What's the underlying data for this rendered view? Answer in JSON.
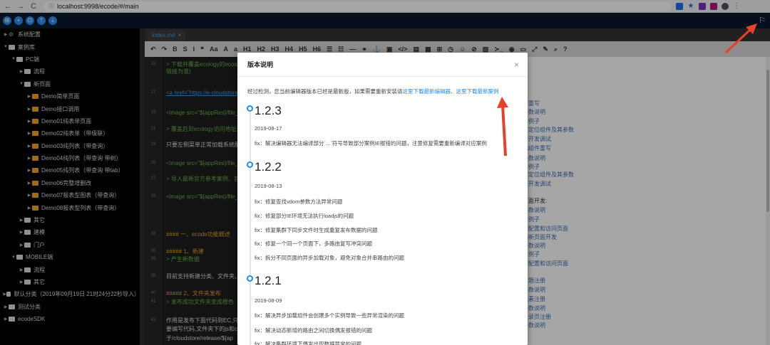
{
  "browser": {
    "url": "localhost:9998/ecode/#/main",
    "back": "←",
    "forward": "→",
    "reload": "C"
  },
  "appbar": {
    "tools": [
      "⊞",
      "+",
      "⊡",
      "⤒",
      "⤓"
    ],
    "flag": "⚐"
  },
  "sidebar": {
    "items": [
      {
        "label": "系统配置",
        "depth": 0,
        "icon": "gear"
      },
      {
        "label": "案例库",
        "depth": 0,
        "icon": "white",
        "open": true
      },
      {
        "label": "PC端",
        "depth": 1,
        "icon": "white",
        "open": true
      },
      {
        "label": "流程",
        "depth": 2,
        "icon": "white"
      },
      {
        "label": "新页面",
        "depth": 2,
        "icon": "white",
        "open": true
      },
      {
        "label": "Demo简单页面",
        "depth": 3,
        "icon": "orange"
      },
      {
        "label": "Demo接口调用",
        "depth": 3,
        "icon": "orange"
      },
      {
        "label": "Demo01纯表单页面",
        "depth": 3,
        "icon": "orange"
      },
      {
        "label": "Demo02纯表单（带级联）",
        "depth": 3,
        "icon": "orange"
      },
      {
        "label": "Demo03纯列表（带查询）",
        "depth": 3,
        "icon": "orange"
      },
      {
        "label": "Demo04纯列表（带查询 带树）",
        "depth": 3,
        "icon": "orange"
      },
      {
        "label": "Demo05纯列表（带查询 带tab）",
        "depth": 3,
        "icon": "orange"
      },
      {
        "label": "Demo06完整增删改",
        "depth": 3,
        "icon": "orange"
      },
      {
        "label": "Demo07报表型图表（带查询）",
        "depth": 3,
        "icon": "orange"
      },
      {
        "label": "Demo08报表型列表（带查询）",
        "depth": 3,
        "icon": "orange"
      },
      {
        "label": "其它",
        "depth": 2,
        "icon": "white"
      },
      {
        "label": "建模",
        "depth": 2,
        "icon": "white"
      },
      {
        "label": "门户",
        "depth": 2,
        "icon": "white"
      },
      {
        "label": "MOBILE端",
        "depth": 1,
        "icon": "white",
        "open": true
      },
      {
        "label": "流程",
        "depth": 2,
        "icon": "white"
      },
      {
        "label": "其它",
        "depth": 2,
        "icon": "white"
      },
      {
        "label": "默认分类（2019年09月19日 21时24分22秒导入）",
        "depth": 0,
        "icon": "white"
      },
      {
        "label": "测试分类",
        "depth": 0,
        "icon": "white"
      },
      {
        "label": "ecodeSDK",
        "depth": 0,
        "icon": "white"
      }
    ]
  },
  "editor": {
    "tab_label": "index.md",
    "tab_close": "×",
    "toolbar": [
      "↶",
      "↷",
      "B",
      "S",
      "I",
      "❝",
      "Aa",
      "A",
      "a",
      "H1",
      "H2",
      "H3",
      "H4",
      "H5",
      "H6",
      "☰",
      "☷",
      "—",
      "⚭",
      "⚓",
      "▣",
      "</>",
      "▤",
      "▦",
      "⊞",
      "◷",
      "☺",
      "⊘",
      "▨",
      "≻_",
      "◉",
      "▭",
      "⤢",
      "✎",
      "⌕",
      "?"
    ],
    "lines": [
      {
        "n": "15",
        "text": "> 下载并覆盖ecology的ecode",
        "cls": "c-green"
      },
      {
        "n": "",
        "text": "链接为准)",
        "cls": "c-green"
      },
      {
        "n": "17",
        "text": "<a href=\"https://e-cloudstore",
        "cls": "c-link"
      },
      {
        "n": "19",
        "text": "<image src=\"${appRes}/file_",
        "cls": "c-green"
      },
      {
        "n": "21",
        "text": "> 覆盖后到ecology访问地址进",
        "cls": "c-green"
      },
      {
        "n": "23",
        "text": "只要左侧菜单正常加载系统配",
        "cls": "c-white"
      },
      {
        "n": "25",
        "text": "<image src=\"${appRes}/file_",
        "cls": "c-green"
      },
      {
        "n": "27",
        "text": "> 导入最新官方参考案例，首",
        "cls": "c-green"
      },
      {
        "n": "29",
        "text": "<image src=\"${appRes}/file_",
        "cls": "c-green"
      },
      {
        "n": "33",
        "text": "#### 一、ecode功能概述",
        "cls": "c-orange"
      },
      {
        "n": "35",
        "text": "##### 1、新建",
        "cls": "c-orange"
      },
      {
        "n": "36",
        "text": "> 产生新数据",
        "cls": "c-green"
      },
      {
        "n": "38",
        "text": "目前支持新建分类、文件夹、",
        "cls": "c-white"
      },
      {
        "n": "40",
        "text": "##### 2、文件夹发布",
        "cls": "c-orange"
      },
      {
        "n": "41",
        "text": "> 发布成功文件夹变成橙色",
        "cls": "c-green"
      },
      {
        "n": "43",
        "text": "作用是发布下面代码到EC,只有",
        "cls": "c-white"
      },
      {
        "n": "",
        "text": "要编写代码,文件夹下的js和c",
        "cls": "c-white"
      },
      {
        "n": "",
        "text": "于/cloudstore/release/${ap",
        "cls": "c-white"
      }
    ],
    "preview_lines": [
      "件重写",
      "参数说明",
      "本例子",
      "何定位组件及其参数",
      "何开发调试",
      "端组件重写",
      "参数说明",
      "本例子",
      "何定位组件及其参数",
      "何开发调试",
      "页面开发:",
      "参数说明",
      "本例子",
      "何配置和访问页面",
      "端新页面开发",
      "参数说明",
      "本例子",
      "何配置和访问页面",
      "主题注册",
      "参数说明",
      "元素注册",
      "参数说明",
      "登录页注册",
      "参数说明"
    ]
  },
  "modal": {
    "title": "版本说明",
    "close": "×",
    "notice_prefix": "经过检测，您当前编辑器版本已经是最新版，如果需要重新安装请",
    "link1": "这里下载最新编辑器",
    "sep": "、",
    "link2": "这里下载最新案例",
    "versions": [
      {
        "version": "1.2.3",
        "date": "2019-08-17",
        "fixes": [
          "fix：解决编辑器无法编译部分`...`符号导致部分案例IE报错的问题，注意修复需要重新编译对应案例"
        ]
      },
      {
        "version": "1.2.2",
        "date": "2019-08-13",
        "fixes": [
          "fix：修复查找vdom参数方法异常问题",
          "fix：修复部分IE环境无法执行loadjs的问题",
          "fix：修复集群下同步文件时生成重复发布数据的问题",
          "fix：修复一个同一个页面下，多路由复写冲突问题",
          "fix：拆分不同页面的异步加载对象，避免对象合并串路由的问题"
        ]
      },
      {
        "version": "1.2.1",
        "date": "2019-08-09",
        "fixes": [
          "fix：解决异步加载组件会创建多个实例导致一些异常渲染的问题",
          "fix：解决动态新增的路由之间切换偶发报错的问题",
          "fix：解决集群环境下偶发出现数据异常的问题"
        ]
      }
    ]
  },
  "colors": {
    "accent": "#1f8ceb",
    "annotation_arrow": "#e8402a",
    "folder_orange": "#f5a623"
  }
}
